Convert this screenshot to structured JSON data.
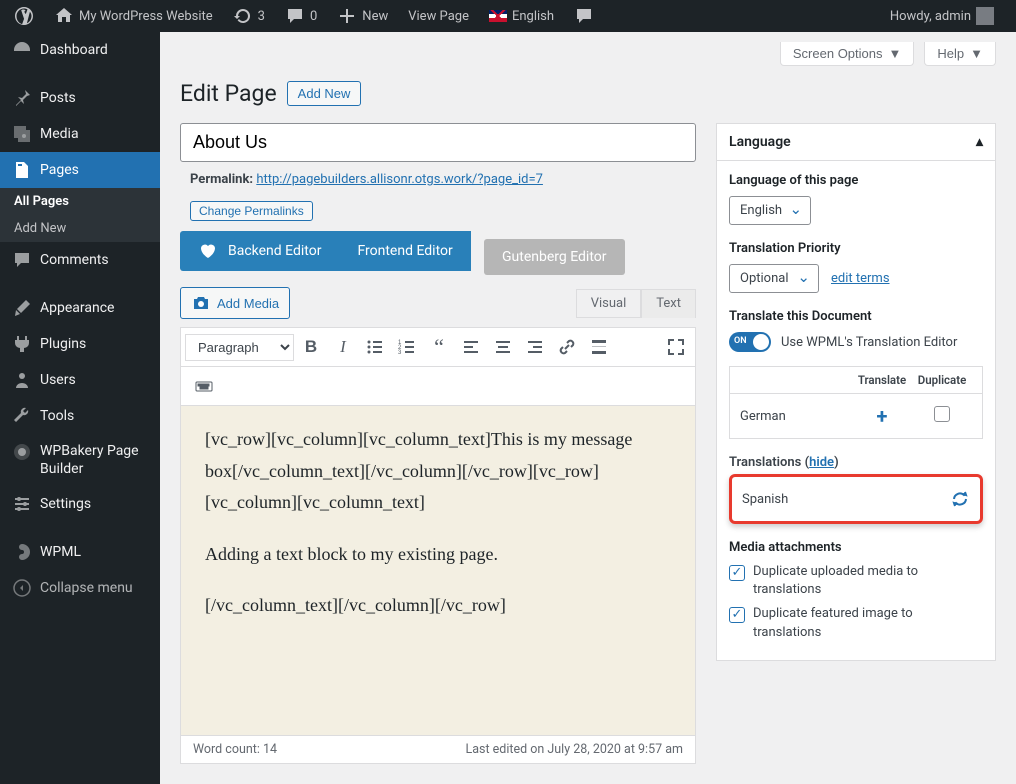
{
  "adminbar": {
    "site_name": "My WordPress Website",
    "updates": "3",
    "comments": "0",
    "new_label": "New",
    "view_page": "View Page",
    "language": "English",
    "howdy": "Howdy, admin"
  },
  "sidebar": {
    "items": [
      {
        "label": "Dashboard"
      },
      {
        "label": "Posts"
      },
      {
        "label": "Media"
      },
      {
        "label": "Pages"
      },
      {
        "label": "Comments"
      },
      {
        "label": "Appearance"
      },
      {
        "label": "Plugins"
      },
      {
        "label": "Users"
      },
      {
        "label": "Tools"
      },
      {
        "label": "WPBakery Page Builder"
      },
      {
        "label": "Settings"
      },
      {
        "label": "WPML"
      },
      {
        "label": "Collapse menu"
      }
    ],
    "submenu": [
      {
        "label": "All Pages"
      },
      {
        "label": "Add New"
      }
    ]
  },
  "top": {
    "screen_options": "Screen Options",
    "help": "Help"
  },
  "heading": {
    "title": "Edit Page",
    "add_new": "Add New"
  },
  "main": {
    "title_value": "About Us",
    "permalink_label": "Permalink:",
    "permalink_url": "http://pagebuilders.allisonr.otgs.work/?page_id=7",
    "change_permalinks": "Change Permalinks",
    "backend_editor": "Backend Editor",
    "frontend_editor": "Frontend Editor",
    "gutenberg_editor": "Gutenberg Editor",
    "add_media": "Add Media",
    "tab_visual": "Visual",
    "tab_text": "Text",
    "format_select": "Paragraph",
    "editor_content_1": "[vc_row][vc_column][vc_column_text]This is my message box[/vc_column_text][/vc_column][/vc_row][vc_row][vc_column][vc_column_text]",
    "editor_content_2": "Adding a text block to my existing page.",
    "editor_content_3": "[/vc_column_text][/vc_column][/vc_row]",
    "word_count": "Word count: 14",
    "last_edited": "Last edited on July 28, 2020 at 9:57 am"
  },
  "language_panel": {
    "header": "Language",
    "lang_of_page": "Language of this page",
    "lang_value": "English",
    "priority_label": "Translation Priority",
    "priority_value": "Optional",
    "edit_terms": "edit terms",
    "translate_doc": "Translate this Document",
    "toggle_on": "ON",
    "toggle_label": "Use WPML's Translation Editor",
    "th_translate": "Translate",
    "th_duplicate": "Duplicate",
    "lang_german": "German",
    "translations_label": "Translations",
    "hide": "hide",
    "lang_spanish": "Spanish",
    "media_heading": "Media attachments",
    "media_opt_1": "Duplicate uploaded media to translations",
    "media_opt_2": "Duplicate featured image to translations"
  }
}
